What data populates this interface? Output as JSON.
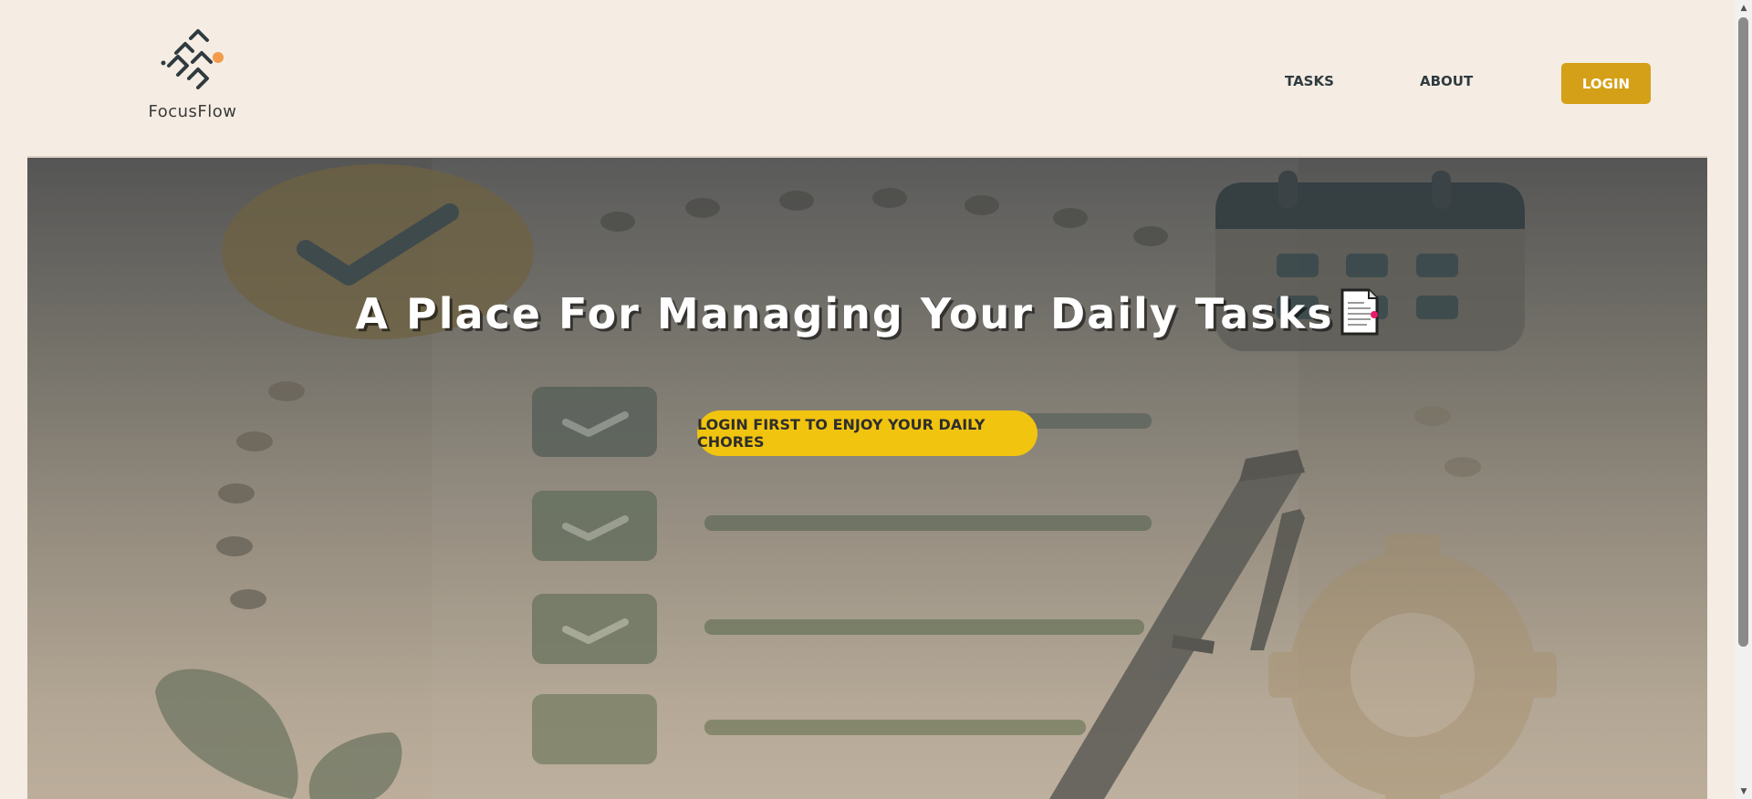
{
  "app": {
    "brand": "FocusFlow"
  },
  "nav": {
    "tasks": "TASKS",
    "about": "ABOUT",
    "login": "LOGIN"
  },
  "hero": {
    "title": "A Place For Managing Your Daily Tasks",
    "cta": "LOGIN FIRST TO ENJOY YOUR DAILY CHORES"
  },
  "colors": {
    "accent": "#d4a017",
    "cta": "#f1c40f",
    "page_bg": "#f5ede3",
    "logo_dot": "#f39c4a"
  },
  "icons": {
    "logo": "focusflow-logo-icon",
    "title_emoji": "document-icon"
  }
}
